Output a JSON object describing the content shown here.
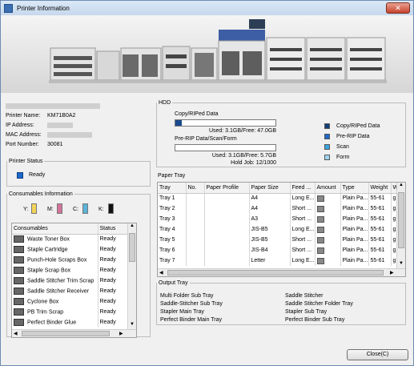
{
  "window": {
    "title": "Printer Information",
    "close_glyph": "✕"
  },
  "printer": {
    "name_label": "Printer Name:",
    "name_value": "KM71B0A2",
    "ip_label": "IP Address:",
    "mac_label": "MAC Address:",
    "port_label": "Port Number:",
    "port_value": "30081"
  },
  "status": {
    "legend": "Printer Status",
    "value": "Ready"
  },
  "consumables": {
    "legend": "Consumables Information",
    "toners": [
      {
        "label": "Y:",
        "color": "#f2d35a"
      },
      {
        "label": "M:",
        "color": "#d4739a"
      },
      {
        "label": "C:",
        "color": "#5cb4d8"
      },
      {
        "label": "K:",
        "color": "#111111"
      }
    ],
    "columns": [
      "Consumables",
      "Status"
    ],
    "rows": [
      {
        "name": "Waste Toner Box",
        "status": "Ready"
      },
      {
        "name": "Staple Cartridge",
        "status": "Ready"
      },
      {
        "name": "Punch-Hole Scraps Box",
        "status": "Ready"
      },
      {
        "name": "Staple Scrap Box",
        "status": "Ready"
      },
      {
        "name": "Saddle Stitcher Trim Scrap",
        "status": "Ready"
      },
      {
        "name": "Saddle Stitcher Receiver",
        "status": "Ready"
      },
      {
        "name": "Cyclone Box",
        "status": "Ready"
      },
      {
        "name": "PB Trim Scrap",
        "status": "Ready"
      },
      {
        "name": "Perfect Binder Glue",
        "status": "Ready"
      }
    ]
  },
  "hdd": {
    "legend": "HDD",
    "copy_label": "Copy/RIPed Data",
    "copy_used": "Used: 3.1GB/Free: 47.0GB",
    "copy_fraction": 0.062,
    "prerip_label": "Pre-RIP Data/Scan/Form",
    "prerip_used": "Used: 3.1GB/Free: 5.7GB",
    "prerip_fraction": 0.0,
    "hold_job": "Hold Job: 12/1000",
    "legend_items": [
      {
        "label": "Copy/RIPed Data",
        "color": "#123f7a"
      },
      {
        "label": "Pre-RIP Data",
        "color": "#1e68c9"
      },
      {
        "label": "Scan",
        "color": "#3aa7e0"
      },
      {
        "label": "Form",
        "color": "#9fd6f2"
      }
    ]
  },
  "paper_tray": {
    "legend": "Paper Tray",
    "columns": [
      "Tray",
      "No.",
      "Paper Profile",
      "Paper Size",
      "Feed ...",
      "Amount",
      "Type",
      "Weight",
      "W"
    ],
    "rows": [
      {
        "tray": "Tray 1",
        "no": "",
        "profile": "",
        "size": "A4",
        "feed": "Long E...",
        "type": "Plain Pa...",
        "weight": "55-61",
        "w": "g."
      },
      {
        "tray": "Tray 2",
        "no": "",
        "profile": "",
        "size": "A4",
        "feed": "Short ...",
        "type": "Plain Pa...",
        "weight": "55-61",
        "w": "g."
      },
      {
        "tray": "Tray 3",
        "no": "",
        "profile": "",
        "size": "A3",
        "feed": "Short ...",
        "type": "Plain Pa...",
        "weight": "55-61",
        "w": "g."
      },
      {
        "tray": "Tray 4",
        "no": "",
        "profile": "",
        "size": "JIS-B5",
        "feed": "Long E...",
        "type": "Plain Pa...",
        "weight": "55-61",
        "w": "g."
      },
      {
        "tray": "Tray 5",
        "no": "",
        "profile": "",
        "size": "JIS-B5",
        "feed": "Short ...",
        "type": "Plain Pa...",
        "weight": "55-61",
        "w": "g."
      },
      {
        "tray": "Tray 6",
        "no": "",
        "profile": "",
        "size": "JIS-B4",
        "feed": "Short ...",
        "type": "Plain Pa...",
        "weight": "55-61",
        "w": "g."
      },
      {
        "tray": "Tray 7",
        "no": "",
        "profile": "",
        "size": "Letter",
        "feed": "Long E...",
        "type": "Plain Pa...",
        "weight": "55-61",
        "w": "g."
      }
    ]
  },
  "output_tray": {
    "legend": "Output Tray",
    "left": [
      "Multi Folder Sub Tray",
      "Saddle-Stitcher Sub Tray",
      "Stapler Main Tray",
      "Perfect Binder Main Tray"
    ],
    "right": [
      "Saddle Stitcher",
      "Saddle Stitcher Folder Tray",
      "Stapler Sub Tray",
      "Perfect Binder Sub Tray"
    ]
  },
  "footer": {
    "close_label": "Close(C)"
  }
}
